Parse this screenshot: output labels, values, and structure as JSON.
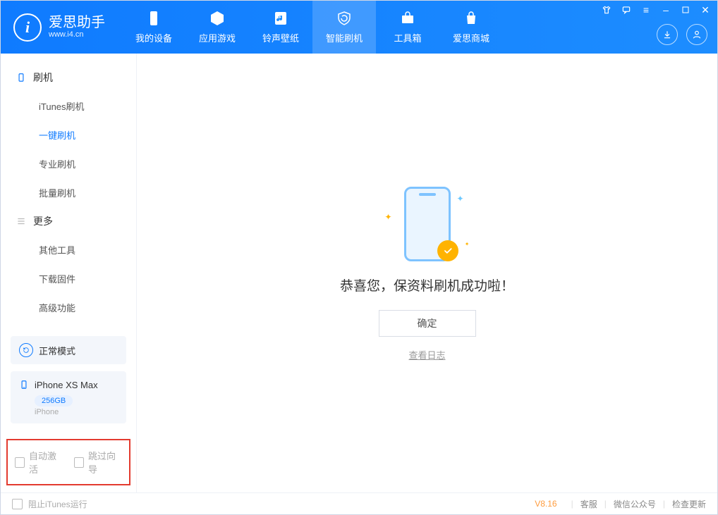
{
  "brand": {
    "title": "爱思助手",
    "sub": "www.i4.cn",
    "logo_letter": "i"
  },
  "nav": {
    "tabs": [
      {
        "label": "我的设备"
      },
      {
        "label": "应用游戏"
      },
      {
        "label": "铃声壁纸"
      },
      {
        "label": "智能刷机"
      },
      {
        "label": "工具箱"
      },
      {
        "label": "爱思商城"
      }
    ],
    "active_index": 3
  },
  "sidebar": {
    "section_flash": {
      "title": "刷机",
      "items": [
        {
          "label": "iTunes刷机"
        },
        {
          "label": "一键刷机"
        },
        {
          "label": "专业刷机"
        },
        {
          "label": "批量刷机"
        }
      ],
      "active_index": 1
    },
    "section_more": {
      "title": "更多",
      "items": [
        {
          "label": "其他工具"
        },
        {
          "label": "下载固件"
        },
        {
          "label": "高级功能"
        }
      ]
    },
    "mode": {
      "label": "正常模式"
    },
    "device": {
      "name": "iPhone XS Max",
      "capacity": "256GB",
      "type": "iPhone"
    },
    "opts": {
      "auto_activate": "自动激活",
      "skip_guide": "跳过向导"
    }
  },
  "main": {
    "success_text": "恭喜您，保资料刷机成功啦！",
    "ok_label": "确定",
    "log_link": "查看日志"
  },
  "footer": {
    "block_itunes": "阻止iTunes运行",
    "version": "V8.16",
    "support": "客服",
    "wechat": "微信公众号",
    "update": "检查更新"
  }
}
